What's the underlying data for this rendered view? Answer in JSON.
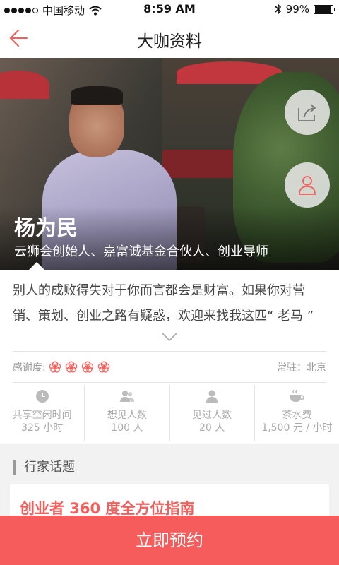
{
  "status_bar": {
    "carrier": "中国移动",
    "time": "8:59 AM",
    "battery": "99%",
    "battery_level": 0.99
  },
  "nav": {
    "title": "大咖资料"
  },
  "profile": {
    "name": "杨为民",
    "role": "云狮会创始人、嘉富诚基金合伙人、创业导师",
    "intro": "别人的成败得失对于你而言都会是财富。如果你对营销、策划、创业之路有疑惑，欢迎来找我这匹“ 老马 ”"
  },
  "meta": {
    "gratitude_label": "感谢度:",
    "gratitude_rating": 4,
    "location": "常驻：北京"
  },
  "stats": [
    {
      "label": "共享空闲时间",
      "value": "325 小时",
      "icon": "clock-icon"
    },
    {
      "label": "想见人数",
      "value": "100 人",
      "icon": "people-icon"
    },
    {
      "label": "见过人数",
      "value": "20 人",
      "icon": "person-icon"
    },
    {
      "label": "茶水费",
      "value": "1,500 元 / 小时",
      "icon": "tea-cup-icon"
    }
  ],
  "topics": {
    "section_title": "行家话题",
    "items": [
      "创业者 360 度全方位指南"
    ]
  },
  "action": {
    "book_label": "立即预约"
  },
  "colors": {
    "accent": "#f75c5c",
    "text": "#444444",
    "muted": "#aaaaaa"
  }
}
